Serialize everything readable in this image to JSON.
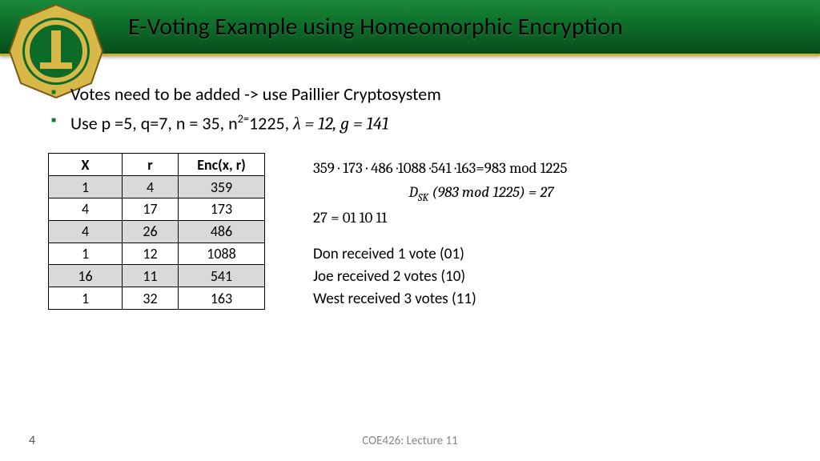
{
  "header": {
    "title": "E-Voting Example using Homeomorphic Encryption"
  },
  "bullets": {
    "b1": "Votes need to be added -> use Paillier Cryptosystem",
    "b2_prefix": "Use p =5, q=7, n = 35, n",
    "b2_sup": "2=",
    "b2_mid": "1225, ",
    "b2_math": "λ = 12, g = 141"
  },
  "table": {
    "headers": {
      "h1": "X",
      "h2": "r",
      "h3": "Enc(x, r)"
    },
    "rows": [
      {
        "x": "1",
        "r": "4",
        "e": "359"
      },
      {
        "x": "4",
        "r": "17",
        "e": "173"
      },
      {
        "x": "4",
        "r": "26",
        "e": "486"
      },
      {
        "x": "1",
        "r": "12",
        "e": "1088"
      },
      {
        "x": "16",
        "r": "11",
        "e": "541"
      },
      {
        "x": "1",
        "r": "32",
        "e": "163"
      }
    ]
  },
  "math": {
    "product": "359  · 173 · 486 ·1088 ·541 ·163=983 mod 1225",
    "decrypt_a": "D",
    "decrypt_sub": "SK",
    "decrypt_b": " (983 mod 1225) = 27",
    "binary": "27 = 01 10 11"
  },
  "results": {
    "r1": "Don received 1 vote (01)",
    "r2": "Joe received 2 votes (10)",
    "r3": "West received 3 votes (11)"
  },
  "footer": {
    "page": "4",
    "lecture": "COE426: Lecture 11"
  }
}
